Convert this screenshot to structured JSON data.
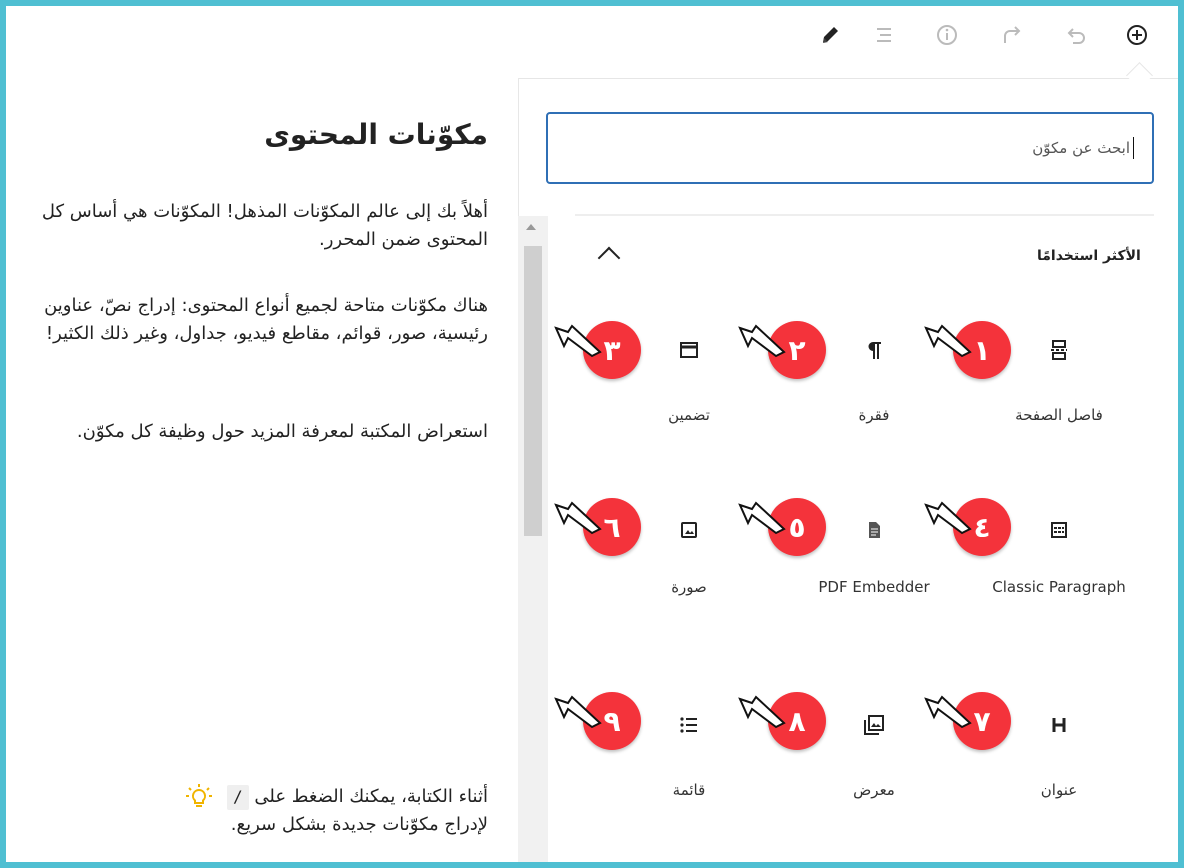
{
  "toolbar": {
    "tools": [
      {
        "name": "pencil-icon",
        "label": "edit"
      },
      {
        "name": "list-view-icon",
        "label": "list view"
      },
      {
        "name": "info-icon",
        "label": "information"
      },
      {
        "name": "redo-icon",
        "label": "redo"
      },
      {
        "name": "undo-icon",
        "label": "undo"
      },
      {
        "name": "add-block-icon",
        "label": "add block"
      }
    ]
  },
  "search": {
    "value": "ابحث عن مكوّن"
  },
  "section": {
    "title": "الأكثر استخدامًا"
  },
  "blocks": [
    {
      "label": "فاصل الصفحة",
      "icon": "page-break-icon",
      "badge": "١"
    },
    {
      "label": "فقرة",
      "icon": "paragraph-icon",
      "badge": "٢"
    },
    {
      "label": "تضمين",
      "icon": "embed-icon",
      "badge": "٣"
    },
    {
      "label": "Classic Paragraph",
      "icon": "classic-paragraph-icon",
      "badge": "٤"
    },
    {
      "label": "PDF Embedder",
      "icon": "pdf-document-icon",
      "badge": "٥"
    },
    {
      "label": "صورة",
      "icon": "image-icon",
      "badge": "٦"
    },
    {
      "label": "عنوان",
      "icon": "heading-icon",
      "badge": "٧"
    },
    {
      "label": "معرض",
      "icon": "gallery-icon",
      "badge": "٨"
    },
    {
      "label": "قائمة",
      "icon": "list-icon",
      "badge": "٩"
    }
  ],
  "sidebar": {
    "title": "مكوّنات المحتوى",
    "paragraphs": [
      "أهلاً بك إلى عالم المكوّنات المذهل! المكوّنات هي أساس كل المحتوى ضمن المحرر.",
      "هناك مكوّنات متاحة لجميع أنواع المحتوى: إدراج نصّ، عناوين رئيسية، صور، قوائم، مقاطع فيديو، جداول، وغير ذلك الكثير!",
      "استعراض المكتبة لمعرفة المزيد حول وظيفة كل مكوّن."
    ],
    "tip_before": "أثناء الكتابة، يمكنك الضغط على",
    "tip_key": "/",
    "tip_after": "لإدراج مكوّنات جديدة بشكل سريع."
  },
  "colors": {
    "frame": "#4fbfd2",
    "badge": "#f4333b",
    "search_border": "#2f6fb5"
  }
}
